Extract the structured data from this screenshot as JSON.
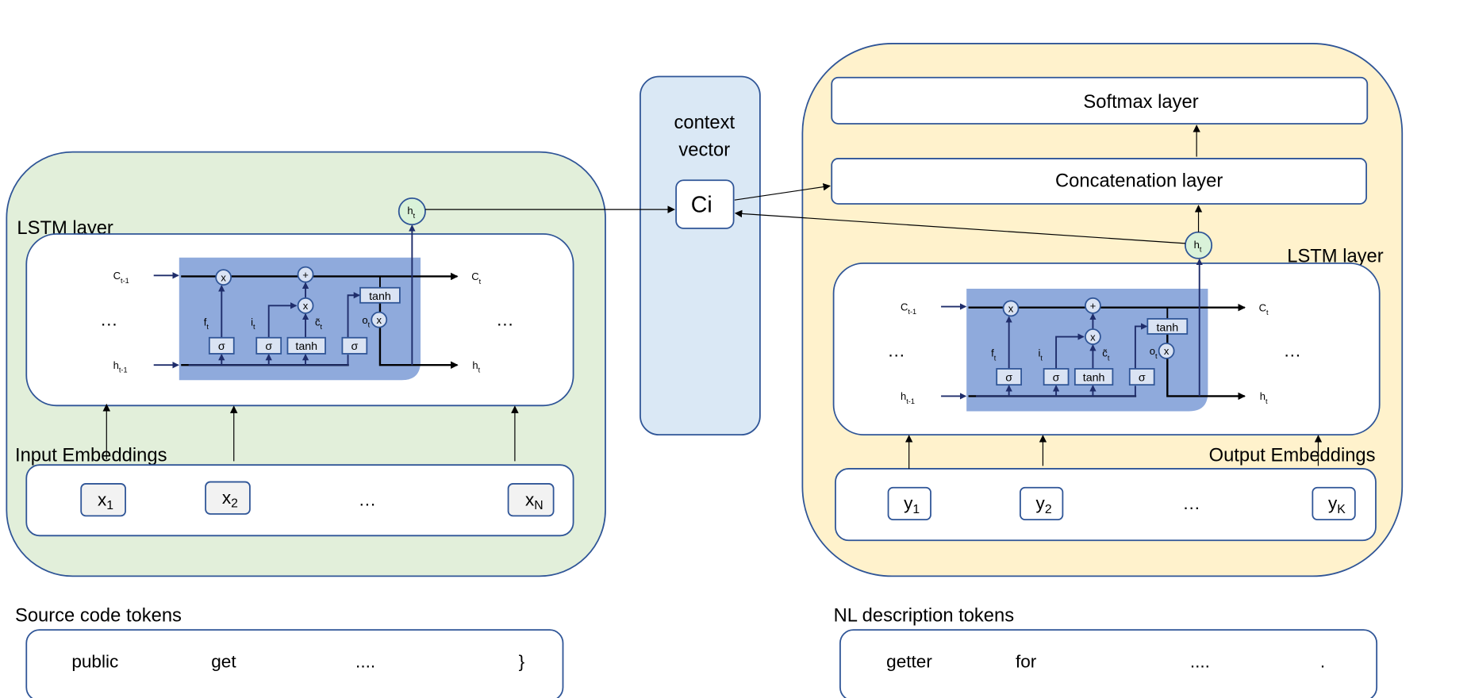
{
  "encoder": {
    "layer_label": "LSTM layer",
    "embeddings_label": "Input Embeddings",
    "tokens_label": "Source code tokens",
    "embeddings": [
      {
        "main": "x",
        "sub": "1"
      },
      {
        "main": "x",
        "sub": "2"
      },
      {
        "main": "x",
        "sub": "N"
      }
    ],
    "ellipsis": "…",
    "tokens": [
      "public",
      "get",
      "....",
      "}"
    ]
  },
  "context": {
    "title_line1": "context",
    "title_line2": "vector",
    "node": "Ci"
  },
  "decoder": {
    "softmax_label": "Softmax layer",
    "concat_label": "Concatenation layer",
    "layer_label": "LSTM layer",
    "embeddings_label": "Output Embeddings",
    "tokens_label": "NL description tokens",
    "embeddings": [
      {
        "main": "y",
        "sub": "1"
      },
      {
        "main": "y",
        "sub": "2"
      },
      {
        "main": "y",
        "sub": "K"
      }
    ],
    "ellipsis": "…",
    "tokens": [
      "getter",
      "for",
      "....",
      "."
    ]
  },
  "cell": {
    "c_prev": {
      "main": "C",
      "sub": "t-1"
    },
    "c_out": {
      "main": "C",
      "sub": "t"
    },
    "h_prev": {
      "main": "h",
      "sub": "t-1"
    },
    "h_out": {
      "main": "h",
      "sub": "t"
    },
    "f": {
      "main": "f",
      "sub": "t"
    },
    "i": {
      "main": "i",
      "sub": "t"
    },
    "c_tilde": {
      "main": "c͂",
      "sub": "t"
    },
    "o": {
      "main": "o",
      "sub": "t"
    },
    "sigma": "σ",
    "tanh": "tanh",
    "mult": "x",
    "plus": "+",
    "ellipsis": "…"
  },
  "colors": {
    "encoder_bg": "#e2efda",
    "decoder_bg": "#fff2cc",
    "context_bg": "#dae8f5",
    "border": "#2f5597",
    "cell_bg": "#8faadc",
    "gate_bg": "#dae3f3",
    "h_node_bg": "#d9f2d9"
  }
}
